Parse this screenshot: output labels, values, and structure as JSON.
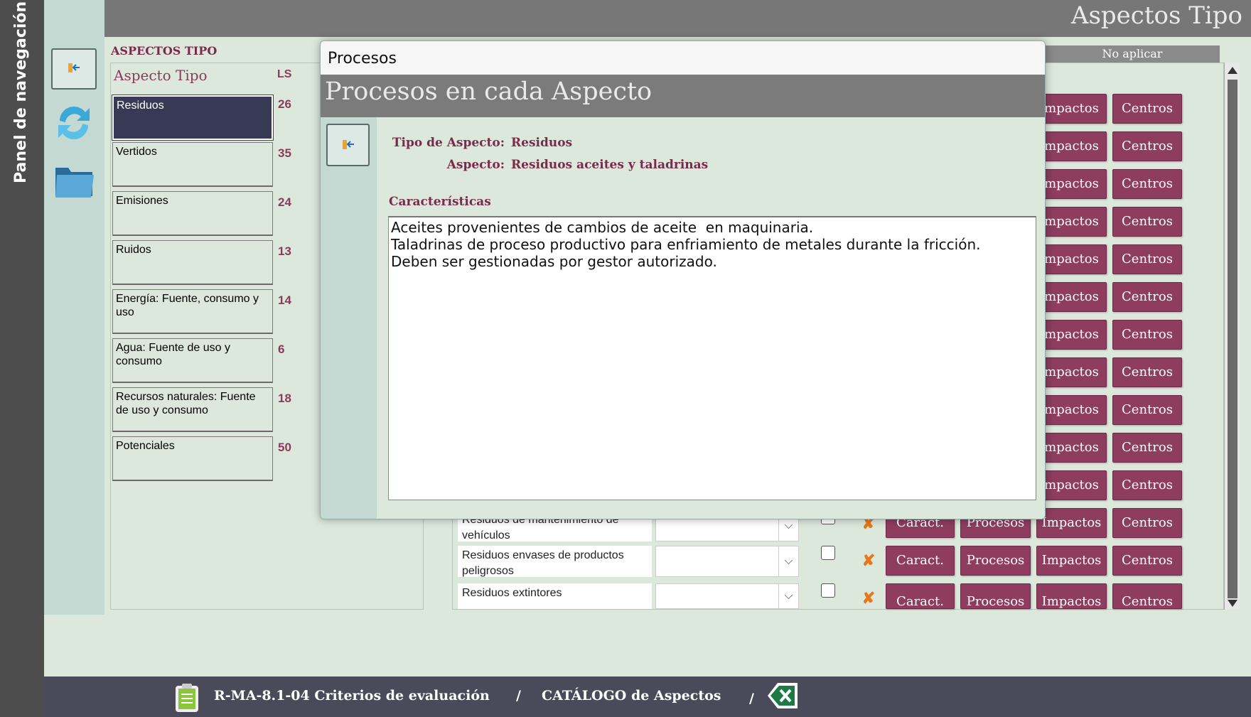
{
  "nav": {
    "panel_label": "Panel de navegación"
  },
  "header": {
    "title": "Aspectos Tipo"
  },
  "list": {
    "heading": "ASPECTOS TIPO",
    "col_name": "Aspecto Tipo",
    "col_ls": "LS",
    "items": [
      {
        "label": "Residuos",
        "ls": "26"
      },
      {
        "label": "Vertidos",
        "ls": "35"
      },
      {
        "label": "Emisiones",
        "ls": "24"
      },
      {
        "label": "Ruidos",
        "ls": "13"
      },
      {
        "label": "Energía: Fuente, consumo y uso",
        "ls": "14"
      },
      {
        "label": "Agua: Fuente  de uso y consumo",
        "ls": "6"
      },
      {
        "label": "Recursos naturales: Fuente de uso  y consumo",
        "ls": "18"
      },
      {
        "label": "Potenciales",
        "ls": "50"
      }
    ]
  },
  "grid": {
    "no_aplicar": "No aplicar",
    "buttons": {
      "caract": "Caract.",
      "procesos": "Procesos",
      "impactos": "Impactos",
      "centros": "Centros"
    },
    "impactos_partial": "mpactos",
    "rows": [
      {
        "name": "Residuos de mantenimiento de vehículos"
      },
      {
        "name": "Residuos envases de productos peligrosos"
      },
      {
        "name": "Residuos extintores"
      }
    ]
  },
  "modal": {
    "window_title": "Procesos",
    "header": "Procesos en cada Aspecto",
    "tipo_label": "Tipo de Aspecto:",
    "tipo_value": "Residuos",
    "aspecto_label": "Aspecto:",
    "aspecto_value": "Residuos aceites y taladrinas",
    "caracteristicas_label": "Características",
    "caracteristicas_text": "Aceites provenientes de cambios de aceite  en maquinaria.\nTaladrinas de proceso productivo para enfriamiento de metales durante la fricción.\nDeben ser gestionadas por gestor autorizado."
  },
  "bottom": {
    "doc_label": "R-MA-8.1-04 Criterios de evaluación",
    "separator": "/",
    "catalog_label": "CATÁLOGO de Aspectos"
  },
  "colors": {
    "accent": "#8e3d5f",
    "header": "#777777",
    "background": "#dde8dd",
    "selected": "#383a55"
  }
}
